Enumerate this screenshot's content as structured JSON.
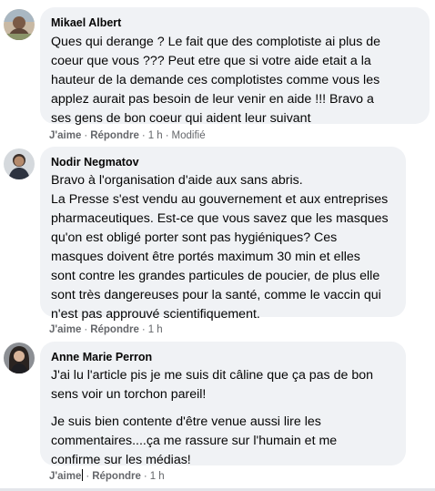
{
  "comments": [
    {
      "author": "Mikael Albert",
      "lines": [
        "Ques qui derange ? Le fait que des complotiste ai plus de",
        "coeur que vous ??? Peut etre que si votre aide etait a la",
        "hauteur de la demande ces complotistes comme vous les",
        "applez aurait pas besoin de leur venir en aide !!! Bravo a",
        "ses gens de bon coeur qui aident leur suivant"
      ],
      "like": "J'aime",
      "reply": "Répondre",
      "time": "1 h",
      "edited": "Modifié"
    },
    {
      "author": "Nodir Negmatov",
      "lines": [
        "Bravo à l'organisation d'aide aux sans abris.",
        "La Presse s'est vendu au gouvernement et aux entreprises",
        "pharmaceutiques. Est-ce que vous savez que les masques",
        "qu'on est obligé porter sont pas hygiéniques? Ces",
        "masques doivent être portés maximum 30 min et elles",
        "sont contre les grandes particules de poucier, de plus elle",
        "sont très dangereuses pour la santé, comme le vaccin qui",
        "n'est pas approuvé scientifiquement."
      ],
      "like": "J'aime",
      "reply": "Répondre",
      "time": "1 h"
    },
    {
      "author": "Anne Marie Perron",
      "para1": [
        "J'ai lu l'article pis je me suis dit câline que ça pas de bon",
        "sens voir un torchon pareil!"
      ],
      "para2": [
        "Je suis bien contente d'être venue aussi lire les",
        "commentaires....ça me rassure sur l'humain et me",
        "confirme sur les médias!"
      ],
      "like": "J'aime",
      "reply": "Répondre",
      "time": "1 h"
    }
  ],
  "separator": "·",
  "colors": {
    "bubble": "#f0f2f5",
    "meta": "#65676b",
    "text": "#050505"
  }
}
